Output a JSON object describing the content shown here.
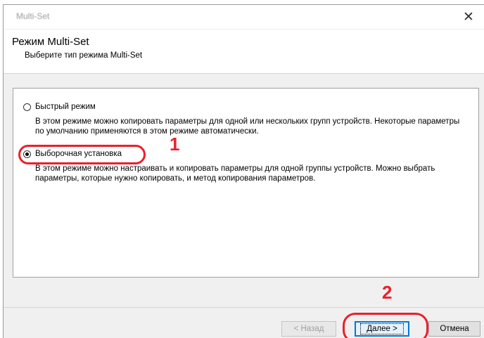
{
  "window": {
    "title": "Multi-Set",
    "close_symbol": "✕"
  },
  "header": {
    "title": "Режим Multi-Set",
    "subtitle": "Выберите тип режима Multi-Set"
  },
  "options": [
    {
      "label": "Быстрый режим",
      "selected": false,
      "description": "В этом режиме можно копировать параметры для одной или нескольких групп устройств. Некоторые параметры по умолчанию применяются в этом режиме автоматически."
    },
    {
      "label": "Выборочная установка",
      "selected": true,
      "description": "В этом режиме можно настраивать и копировать параметры для одной группы устройств. Можно выбрать параметры, которые нужно копировать, и метод копирования параметров."
    }
  ],
  "annotations": {
    "step1": "1",
    "step2": "2",
    "highlight_color": "#e8212c"
  },
  "buttons": {
    "back": "< Назад",
    "next": "Далее >",
    "cancel": "Отмена"
  }
}
